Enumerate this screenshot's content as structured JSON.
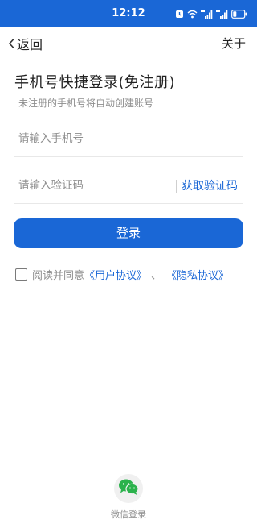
{
  "status_bar": {
    "time": "12:12",
    "background_color": "#1a67d6",
    "icons": [
      "alarm-icon",
      "wifi-icon",
      "signal-5g-icon",
      "signal-4g-icon",
      "battery-icon"
    ]
  },
  "header": {
    "back_label": "返回",
    "about_label": "关于"
  },
  "form": {
    "title": "手机号快捷登录(免注册)",
    "subtitle": "未注册的手机号将自动创建账号",
    "phone_placeholder": "请输入手机号",
    "phone_value": "",
    "code_placeholder": "请输入验证码",
    "code_value": "",
    "get_code_label": "获取验证码",
    "login_label": "登录"
  },
  "agreement": {
    "checked": false,
    "prefix": "阅读并同意",
    "user_agreement": "《用户协议》",
    "separator": "、",
    "privacy_policy": "《隐私协议》"
  },
  "wechat": {
    "label": "微信登录",
    "icon": "wechat-icon"
  },
  "colors": {
    "accent": "#1a67d6",
    "muted_text": "#8e8e8e",
    "divider": "#e8e8e8"
  }
}
